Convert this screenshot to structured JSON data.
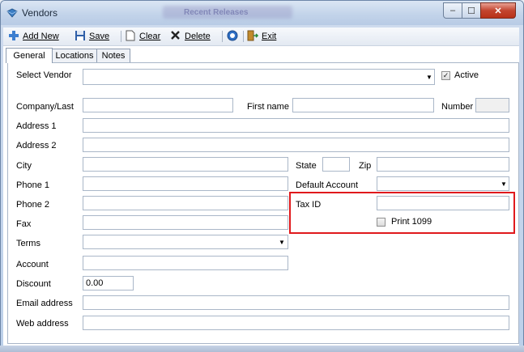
{
  "window": {
    "title": "Vendors",
    "background_title": "Recent Releases",
    "controls": {
      "minimize": "–",
      "maximize": "☐",
      "close": "✕"
    }
  },
  "toolbar": {
    "add_new": "Add New",
    "save": "Save",
    "clear": "Clear",
    "delete": "Delete",
    "exit": "Exit"
  },
  "tabs": [
    "General",
    "Locations",
    "Notes"
  ],
  "form": {
    "select_vendor_label": "Select Vendor",
    "select_vendor_value": "",
    "active_label": "Active",
    "active_checked": "✓",
    "company_label": "Company/Last",
    "first_name_label": "First name",
    "number_label": "Number",
    "address1_label": "Address 1",
    "address2_label": "Address 2",
    "city_label": "City",
    "state_label": "State",
    "zip_label": "Zip",
    "phone1_label": "Phone 1",
    "default_account_label": "Default Account",
    "phone2_label": "Phone 2",
    "tax_id_label": "Tax ID",
    "fax_label": "Fax",
    "print1099_label": "Print 1099",
    "terms_label": "Terms",
    "account_label": "Account",
    "discount_label": "Discount",
    "discount_value": "0.00",
    "email_label": "Email address",
    "web_label": "Web address",
    "dropdown_arrow": "▼"
  },
  "colors": {
    "highlight": "#e0191c",
    "title_bar": "#c3d4ea"
  }
}
